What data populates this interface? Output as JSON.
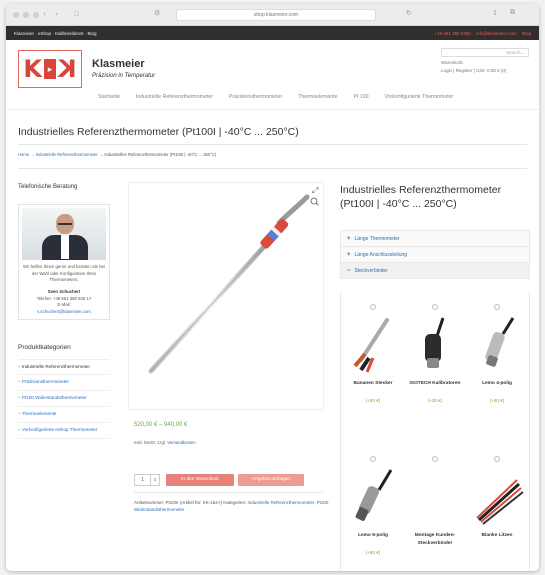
{
  "browser": {
    "url": "shop.klasmeier.com"
  },
  "topbar": {
    "left": "Klasmeier · eShop · Kalibrierdienst · Blog",
    "phone": "+49 661 380 8400",
    "email": "info@klasmeier.com",
    "blog": "Blog"
  },
  "header": {
    "logo_left": "K",
    "logo_right": "K",
    "brand_name": "Klasmeier",
    "slogan": "Präzision in Temperatur",
    "search_placeholder": "Search…",
    "cart_title": "Warenkorb",
    "account_links": "Login | Register | Cart: 0,00 € (0)"
  },
  "nav": [
    "Startseite",
    "Industrielle Referenzthermometer",
    "Präzisionsthermometer",
    "Thermoelemente",
    "Pt 100",
    "Vorkonfigurierte Thermometer"
  ],
  "page": {
    "title": "Industrielles Referenzthermometer (Pt100I | -40°C ... 250°C)",
    "crumb_links": "Home → Industrielle Referenzthermometer → ",
    "crumb_current": "Industrielles Referenzthermometer (Pt100I | -40°C ... 250°C)"
  },
  "sidebar": {
    "heading": "Telefonische Beratung",
    "text1": "Wir helfen Ihnen gerne und beraten Sie bei der Wahl oder Konfiguration Ihres Thermometers.",
    "contact_name": "Sven Schuchert",
    "phone": "Telefon: +49 661 380 840 17",
    "email_label": "E-Mail:",
    "email": "s.schuchert@klasmeier.com",
    "categories_heading": "Produktkategorien",
    "categories": [
      "Industrielle Referenzthermometer",
      "Präzisionsthermometer",
      "Pt100 Widerstandsthermometer",
      "Thermoelemente",
      "Vorkonfigurierte eShop Thermometer"
    ]
  },
  "product": {
    "title": "Industrielles Referenzthermometer (Pt100I | -40°C ... 250°C)",
    "price": "520,00 € – 940,00 €",
    "tax": "exkl. MwSt. zzgl. ",
    "shipping": "Versandkosten",
    "quantity": "1",
    "add_to_cart": "In den Warenkorb",
    "request_offer": "Angebot anfragen",
    "sku_text": "Artikelnummer: Pt100I (Artikel für: KK-164-I) Kategorien: ",
    "sku_categories": "Industrielle Referenzthermometer, Pt100 Widerstandsthermometer"
  },
  "accordion": [
    {
      "label": "Länge Thermometer",
      "sign": "+"
    },
    {
      "label": "Länge Anschlussleitung",
      "sign": "+"
    },
    {
      "label": "Steckverbinder",
      "sign": "−"
    }
  ],
  "options": [
    {
      "label": "Bananen Stecker",
      "price": "(+20 €)"
    },
    {
      "label": "ISOTECH Kalibratoren",
      "price": "(+30 €)"
    },
    {
      "label": "Lemo 4-polig",
      "price": "(+40 €)"
    },
    {
      "label": "Lemo 6-polig",
      "price": "(+60 €)"
    },
    {
      "label": "Montage Kunden-Steckverbinder",
      "price": ""
    },
    {
      "label": "Blanke Litzen",
      "price": ""
    }
  ],
  "colors": {
    "accent_red": "#d8453a",
    "link_blue": "#2f6db5",
    "price_green": "#6bab3d",
    "topbar": "#2f2f2f"
  },
  "icons": [
    "zoom-icon",
    "plus-icon",
    "minus-icon",
    "cart-icon"
  ]
}
